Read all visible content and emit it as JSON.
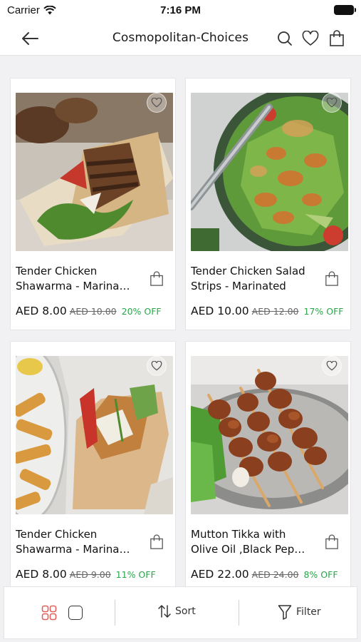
{
  "status_bar": {
    "carrier": "Carrier",
    "time": "7:16 PM"
  },
  "nav": {
    "title": "Cosmopolitan-Choices",
    "back_icon": "back-arrow-icon",
    "search_icon": "search-icon",
    "wishlist_icon": "heart-icon",
    "cart_icon": "shopping-bag-icon"
  },
  "products": [
    {
      "title_line1": "Tender Chicken",
      "title_line2": "Shawarma - Marina…",
      "price": "AED 8.00",
      "old_price": "AED 10.00",
      "discount": "20% OFF"
    },
    {
      "title_line1": "Tender Chicken Salad",
      "title_line2": "Strips - Marinated",
      "price": "AED 10.00",
      "old_price": "AED 12.00",
      "discount": "17% OFF"
    },
    {
      "title_line1": "Tender Chicken",
      "title_line2": "Shawarma - Marina…",
      "price": "AED 8.00",
      "old_price": "AED 9.00",
      "discount": "11% OFF"
    },
    {
      "title_line1": "Mutton Tikka with",
      "title_line2": "Olive Oil ,Black Pep…",
      "price": "AED 22.00",
      "old_price": "AED 24.00",
      "discount": "8% OFF"
    }
  ],
  "bottom_bar": {
    "sort_label": "Sort",
    "filter_label": "Filter",
    "grid_view_icon": "grid-view-icon",
    "single_view_icon": "single-view-icon"
  },
  "colors": {
    "accent_grid_icon": "#e0605a",
    "discount_green": "#2aa64a"
  }
}
